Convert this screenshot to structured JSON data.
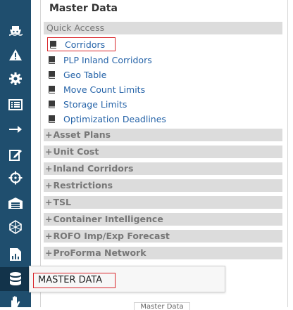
{
  "panel": {
    "title": "Master Data",
    "quick_access": {
      "label": "Quick Access",
      "items": [
        {
          "label": "Corridors",
          "highlighted": true
        },
        {
          "label": "PLP Inland Corridors"
        },
        {
          "label": "Geo Table"
        },
        {
          "label": "Move Count Limits"
        },
        {
          "label": "Storage Limits"
        },
        {
          "label": "Optimization Deadlines"
        }
      ]
    },
    "sections": [
      {
        "label": "Asset Plans"
      },
      {
        "label": "Unit Cost"
      },
      {
        "label": "Inland Corridors"
      },
      {
        "label": "Restrictions"
      },
      {
        "label": "TSL"
      },
      {
        "label": "Container Intelligence"
      },
      {
        "label": "ROFO Imp/Exp Forecast"
      },
      {
        "label": "ProForma Network"
      }
    ]
  },
  "rail": {
    "icons": [
      "ship-icon",
      "warning-icon",
      "gear-icon",
      "list-icon",
      "arrow-right-icon",
      "edit-icon",
      "crosshair-icon",
      "warehouse-icon",
      "globe-icon",
      "chart-icon",
      "database-icon",
      "hand-icon"
    ],
    "active": "database-icon"
  },
  "tooltip": {
    "label": "MASTER DATA"
  },
  "footer_tab": {
    "label": "Master Data"
  },
  "colors": {
    "rail_bg": "#1f4e6e",
    "rail_active": "#12334a",
    "link": "#2563a8",
    "section_bg": "#dcdcdc",
    "highlight": "#d9262b"
  }
}
